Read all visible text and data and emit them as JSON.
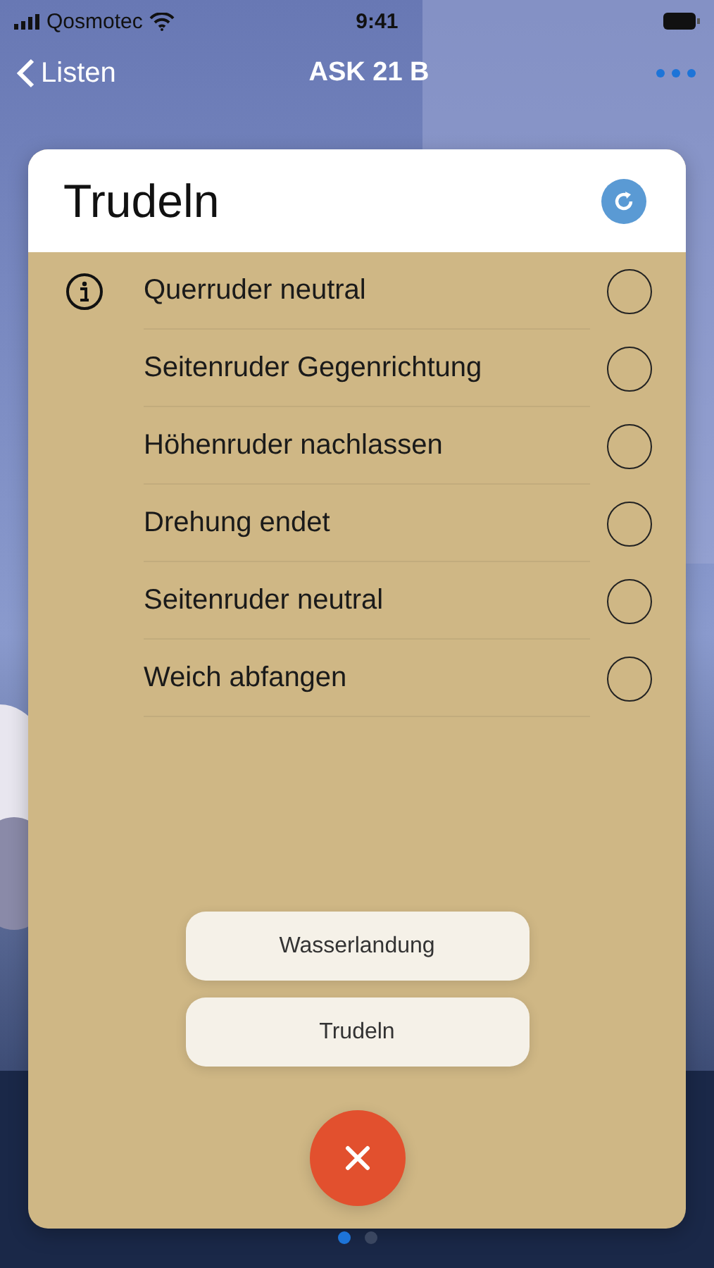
{
  "status_bar": {
    "carrier": "Qosmotec",
    "time": "9:41"
  },
  "nav": {
    "back": "Listen",
    "title": "ASK 21 B"
  },
  "card": {
    "title": "Trudeln",
    "items": [
      {
        "label": "Querruder neutral",
        "info": true,
        "checked": false
      },
      {
        "label": "Seitenruder Gegenrichtung",
        "info": false,
        "checked": false
      },
      {
        "label": "Höhenruder nachlassen",
        "info": false,
        "checked": false
      },
      {
        "label": "Drehung endet",
        "info": false,
        "checked": false
      },
      {
        "label": "Seitenruder neutral",
        "info": false,
        "checked": false
      },
      {
        "label": "Weich abfangen",
        "info": false,
        "checked": false
      }
    ]
  },
  "menu": [
    {
      "label": "Wasserlandung"
    },
    {
      "label": "Trudeln"
    }
  ],
  "pages": [
    {
      "selected": true
    },
    {
      "selected": false
    }
  ]
}
